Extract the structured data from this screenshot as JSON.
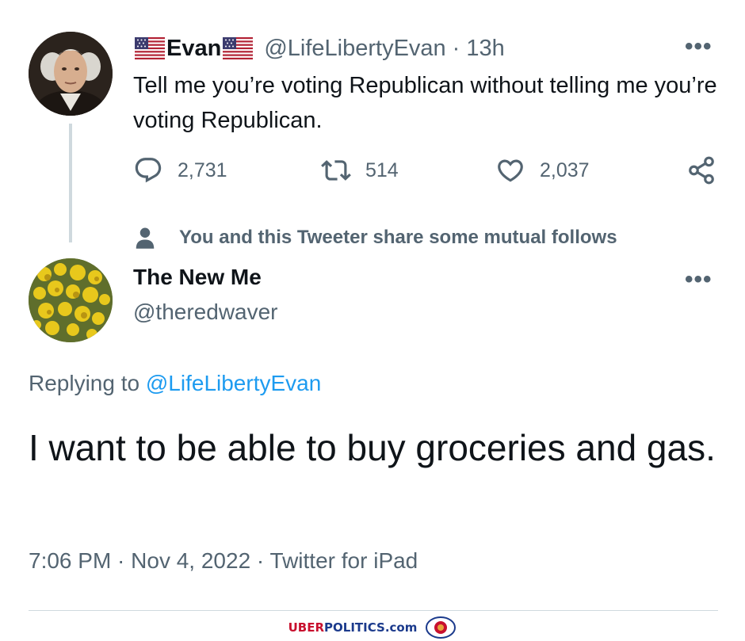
{
  "tweet": {
    "author_name": "Evan",
    "author_handle": "@LifeLibertyEvan",
    "separator": "·",
    "time_ago": "13h",
    "more": "•••",
    "text": "Tell me you’re voting Republican without telling me you’re voting Republican.",
    "replies": "2,731",
    "retweets": "514",
    "likes": "2,037"
  },
  "mutual_notice": "You and this Tweeter share some mutual follows",
  "reply": {
    "author_name": "The New Me",
    "author_handle": "@theredwaver",
    "more": "•••",
    "replying_prefix": "Replying to",
    "replying_handle": "@LifeLibertyEvan",
    "text": "I want to be able to buy groceries and gas.",
    "timestamp": "7:06 PM · Nov 4, 2022 · Twitter for iPad"
  },
  "watermark": {
    "part1": "UBER",
    "part2": "POLITICS.com"
  },
  "colors": {
    "text": "#0f1419",
    "secondary": "#536471",
    "link": "#1d9bf0",
    "thread_line": "#cfd9de"
  },
  "icons": [
    "us-flag-icon",
    "reply-icon",
    "retweet-icon",
    "like-icon",
    "share-icon",
    "person-icon",
    "more-icon",
    "lion-logo-icon"
  ]
}
